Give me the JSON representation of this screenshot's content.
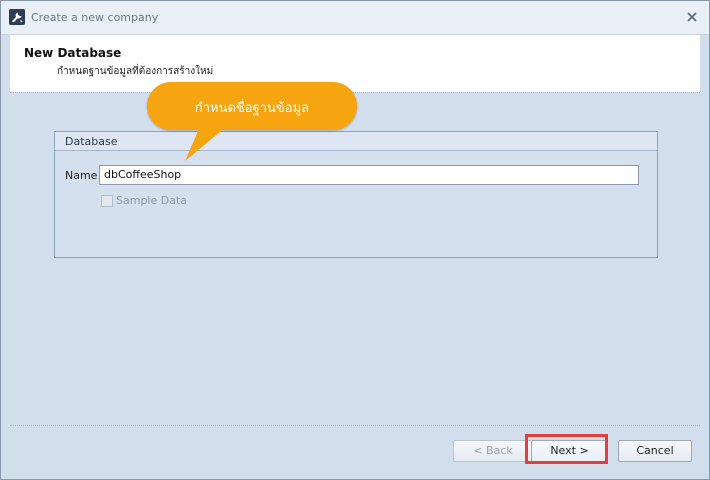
{
  "window": {
    "title": "Create a new company"
  },
  "header": {
    "title": "New Database",
    "subtitle": "กำหนดฐานข้อมูลที่ต้องการสร้างใหม่"
  },
  "callout": {
    "text": "กำหนดชื่อฐานข้อมูล",
    "color": "#f7a411"
  },
  "database_group": {
    "title": "Database",
    "name_label": "Name",
    "name_value": "dbCoffeeShop",
    "sample_data_label": "Sample Data",
    "sample_data_checked": false
  },
  "buttons": {
    "back": "< Back",
    "next": "Next >",
    "cancel": "Cancel"
  },
  "colors": {
    "highlight": "#e0403a",
    "background": "#d3deed"
  }
}
